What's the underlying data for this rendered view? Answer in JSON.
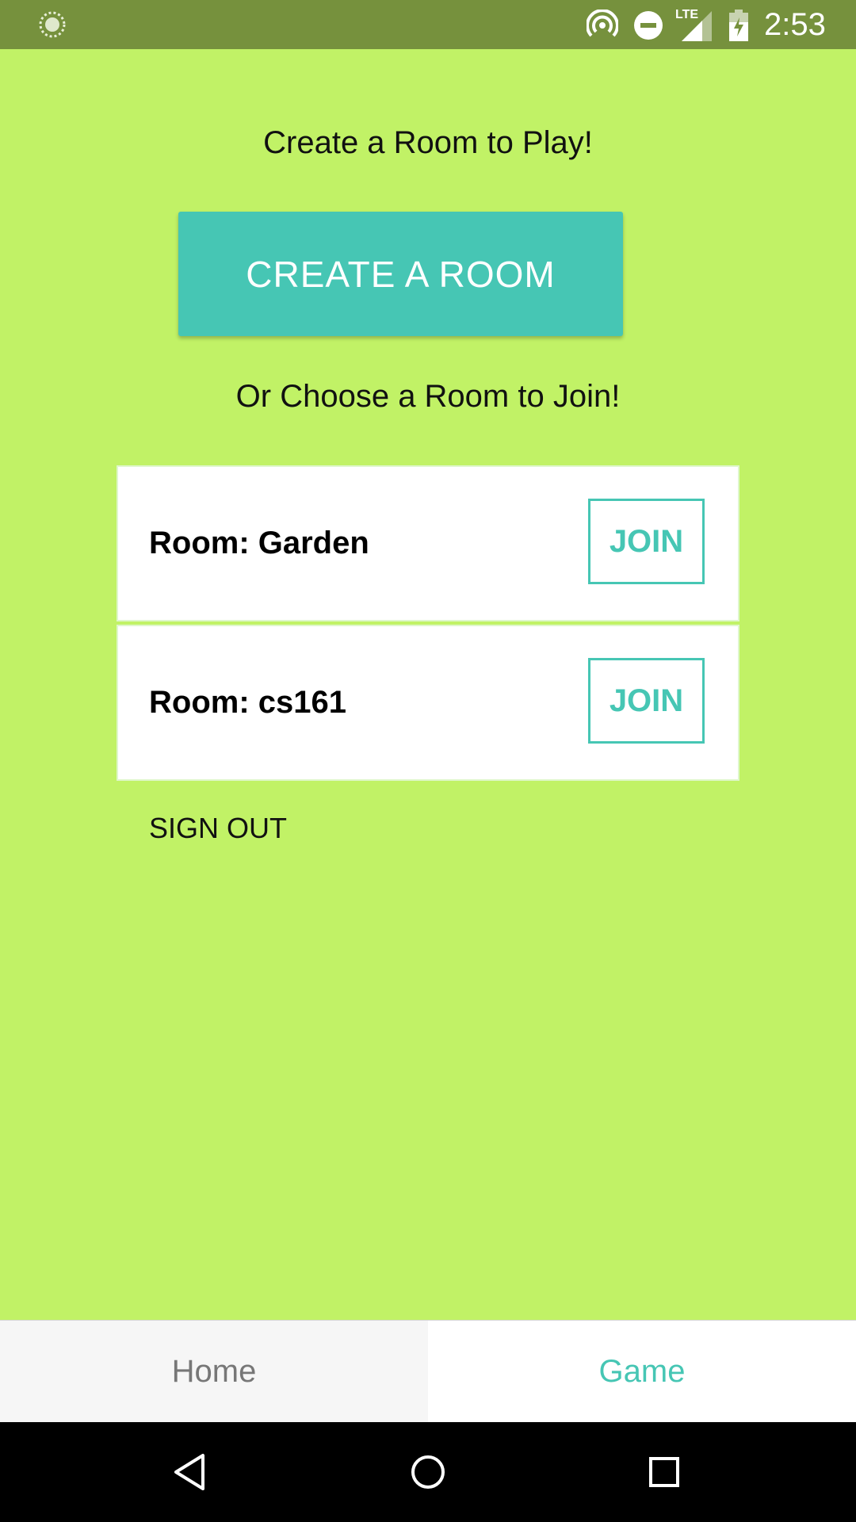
{
  "status_bar": {
    "time": "2:53",
    "icons": [
      "sync-icon",
      "hotspot-icon",
      "do-not-disturb-icon",
      "lte-signal-icon",
      "battery-icon"
    ],
    "network_label": "LTE",
    "background_color": "#76913d"
  },
  "main": {
    "create_heading": "Create a Room to Play!",
    "create_button_label": "CREATE A ROOM",
    "join_heading": "Or Choose a Room to Join!",
    "rooms": [
      {
        "name": "Room: Garden",
        "join_label": "JOIN"
      },
      {
        "name": "Room: cs161",
        "join_label": "JOIN"
      }
    ],
    "sign_out_label": "SIGN OUT",
    "background_color": "#c1f266",
    "accent_color": "#46c6b4"
  },
  "tabs": [
    {
      "label": "Home",
      "selected": false
    },
    {
      "label": "Game",
      "selected": true
    }
  ],
  "nav_bar": {
    "buttons": [
      "back-icon",
      "home-icon",
      "recents-icon"
    ]
  }
}
